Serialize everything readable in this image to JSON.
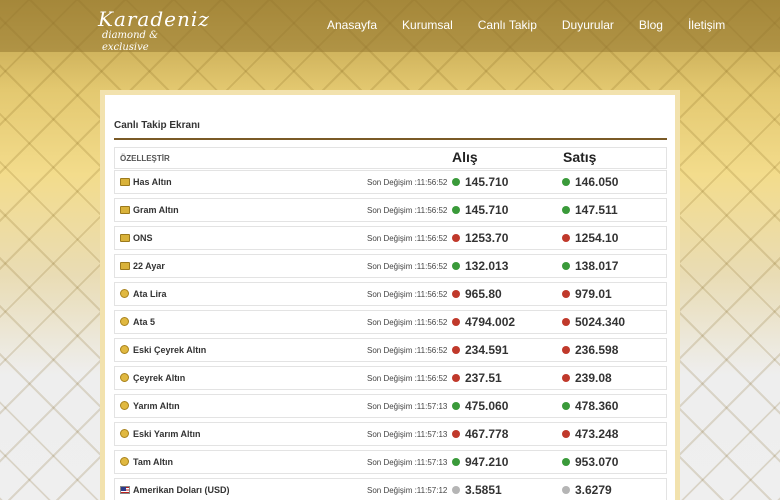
{
  "logo": {
    "line1": "Karadeniz",
    "line2": "diamond & exclusive"
  },
  "nav": [
    "Anasayfa",
    "Kurumsal",
    "Canlı Takip",
    "Duyurular",
    "Blog",
    "İletişim"
  ],
  "panel": {
    "title": "Canlı Takip Ekranı",
    "customize": "ÖZELLEŞTİR",
    "col_buy": "Alış",
    "col_sell": "Satış"
  },
  "rows": [
    {
      "name": "Has Altın",
      "icon": "gold-bar-icon",
      "changed": "Son Değişim :11:56:52",
      "buy": "145.710",
      "buy_dir": "up",
      "sell": "146.050",
      "sell_dir": "up"
    },
    {
      "name": "Gram Altın",
      "icon": "gold-bar-icon",
      "changed": "Son Değişim :11:56:52",
      "buy": "145.710",
      "buy_dir": "up",
      "sell": "147.511",
      "sell_dir": "up"
    },
    {
      "name": "ONS",
      "icon": "gold-bar-icon",
      "changed": "Son Değişim :11:56:52",
      "buy": "1253.70",
      "buy_dir": "down",
      "sell": "1254.10",
      "sell_dir": "down"
    },
    {
      "name": "22 Ayar",
      "icon": "gold-bar-icon",
      "changed": "Son Değişim :11:56:52",
      "buy": "132.013",
      "buy_dir": "up",
      "sell": "138.017",
      "sell_dir": "up"
    },
    {
      "name": "Ata Lira",
      "icon": "gold-coin-icon",
      "changed": "Son Değişim :11:56:52",
      "buy": "965.80",
      "buy_dir": "down",
      "sell": "979.01",
      "sell_dir": "down"
    },
    {
      "name": "Ata 5",
      "icon": "gold-coin-icon",
      "changed": "Son Değişim :11:56:52",
      "buy": "4794.002",
      "buy_dir": "down",
      "sell": "5024.340",
      "sell_dir": "down"
    },
    {
      "name": "Eski Çeyrek Altın",
      "icon": "gold-coin-icon",
      "changed": "Son Değişim :11:56:52",
      "buy": "234.591",
      "buy_dir": "down",
      "sell": "236.598",
      "sell_dir": "down"
    },
    {
      "name": "Çeyrek Altın",
      "icon": "gold-coin-icon",
      "changed": "Son Değişim :11:56:52",
      "buy": "237.51",
      "buy_dir": "down",
      "sell": "239.08",
      "sell_dir": "down"
    },
    {
      "name": "Yarım Altın",
      "icon": "gold-coin-icon",
      "changed": "Son Değişim :11:57:13",
      "buy": "475.060",
      "buy_dir": "up",
      "sell": "478.360",
      "sell_dir": "up"
    },
    {
      "name": "Eski Yarım Altın",
      "icon": "gold-coin-icon",
      "changed": "Son Değişim :11:57:13",
      "buy": "467.778",
      "buy_dir": "down",
      "sell": "473.248",
      "sell_dir": "down"
    },
    {
      "name": "Tam Altın",
      "icon": "gold-coin-icon",
      "changed": "Son Değişim :11:57:13",
      "buy": "947.210",
      "buy_dir": "up",
      "sell": "953.070",
      "sell_dir": "up"
    },
    {
      "name": "Amerikan Doları (USD)",
      "icon": "us-flag-icon",
      "changed": "Son Değişim :11:57:12",
      "buy": "3.5851",
      "buy_dir": "flat",
      "sell": "3.6279",
      "sell_dir": "flat"
    }
  ]
}
